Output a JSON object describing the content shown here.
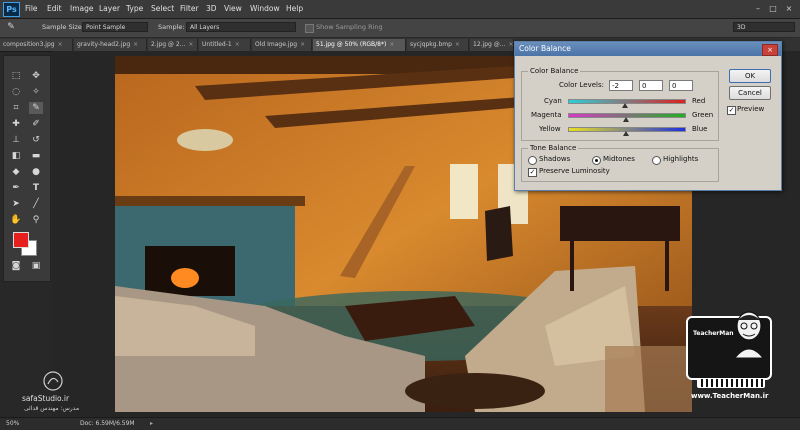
{
  "app": {
    "logo": "Ps"
  },
  "menu": [
    "File",
    "Edit",
    "Image",
    "Layer",
    "Type",
    "Select",
    "Filter",
    "3D",
    "View",
    "Window",
    "Help"
  ],
  "options": {
    "sample_size_label": "Sample Size:",
    "sample_size_value": "Point Sample",
    "sample_label": "Sample:",
    "sample_value": "All Layers",
    "show_ring_label": "Show Sampling Ring",
    "workspace_value": "3D"
  },
  "tabs": [
    {
      "label": "composition3.jpg"
    },
    {
      "label": "gravity-head2.jpg"
    },
    {
      "label": "2.jpg @ 2..."
    },
    {
      "label": "Untitled-1"
    },
    {
      "label": "Old Image.jpg"
    },
    {
      "label": "51.jpg @ 50% (RGB/8*)",
      "active": true
    },
    {
      "label": "sycjqpkg.bmp"
    },
    {
      "label": "12.jpg @..."
    }
  ],
  "tools": [
    "marquee-icon",
    "move-icon",
    "lasso-icon",
    "quick-select-icon",
    "crop-icon",
    "eyedropper-icon",
    "heal-icon",
    "brush-icon",
    "stamp-icon",
    "history-brush-icon",
    "eraser-icon",
    "gradient-icon",
    "blur-icon",
    "dodge-icon",
    "pen-icon",
    "type-icon",
    "path-select-icon",
    "shape-icon",
    "hand-icon",
    "zoom-icon"
  ],
  "colors": {
    "foreground": "#e81f1f",
    "background": "#ffffff",
    "accent": "#3ea0e6"
  },
  "dialog": {
    "title": "Color Balance",
    "color_balance_group": "Color Balance",
    "color_levels_label": "Color Levels:",
    "levels": [
      "-2",
      "0",
      "0"
    ],
    "sliders": [
      {
        "left": "Cyan",
        "right": "Red",
        "value": -2
      },
      {
        "left": "Magenta",
        "right": "Green",
        "value": 0
      },
      {
        "left": "Yellow",
        "right": "Blue",
        "value": 0
      }
    ],
    "tone_group": "Tone Balance",
    "tones": [
      "Shadows",
      "Midtones",
      "Highlights"
    ],
    "selected_tone": "Midtones",
    "preserve_label": "Preserve Luminosity",
    "preserve_checked": true,
    "ok_label": "OK",
    "cancel_label": "Cancel",
    "preview_label": "Preview",
    "preview_checked": true
  },
  "status": {
    "zoom": "50%",
    "doc": "Doc: 6.59M/6.59M"
  },
  "watermark_left": {
    "site": "safaStudio.ir",
    "credit": "مدرس: مهندس قدائی"
  },
  "watermark_right": {
    "brand": "TeacherMan",
    "url": "www.TeacherMan.ir"
  }
}
